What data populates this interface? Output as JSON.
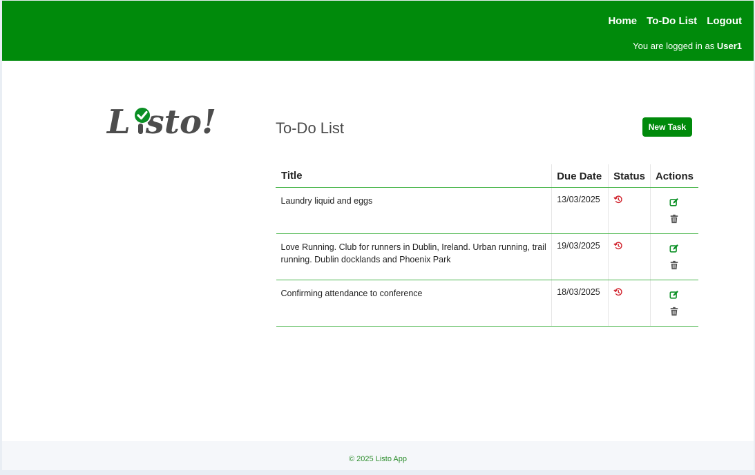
{
  "nav": {
    "home": "Home",
    "todo": "To-Do List",
    "logout": "Logout",
    "login_prefix": "You are logged in as",
    "username": "User1"
  },
  "logo": {
    "text": "Listo!"
  },
  "main": {
    "title": "To-Do List",
    "new_task": "New Task"
  },
  "table": {
    "headers": [
      "Title",
      "Due Date",
      "Status",
      "Actions"
    ],
    "rows": [
      {
        "title": "Laundry liquid and eggs",
        "due": "13/03/2025",
        "status_icon": "history-icon"
      },
      {
        "title": "Love Running. Club for runners in Dublin, Ireland. Urban running, trail running. Dublin docklands and Phoenix Park",
        "due": "19/03/2025",
        "status_icon": "history-icon"
      },
      {
        "title": "Confirming attendance to conference",
        "due": "18/03/2025",
        "status_icon": "history-icon"
      }
    ]
  },
  "footer": {
    "text": "© 2025 Listo App"
  },
  "colors": {
    "brand": "#008a0b",
    "status": "#d0202a",
    "trash": "#555555"
  }
}
